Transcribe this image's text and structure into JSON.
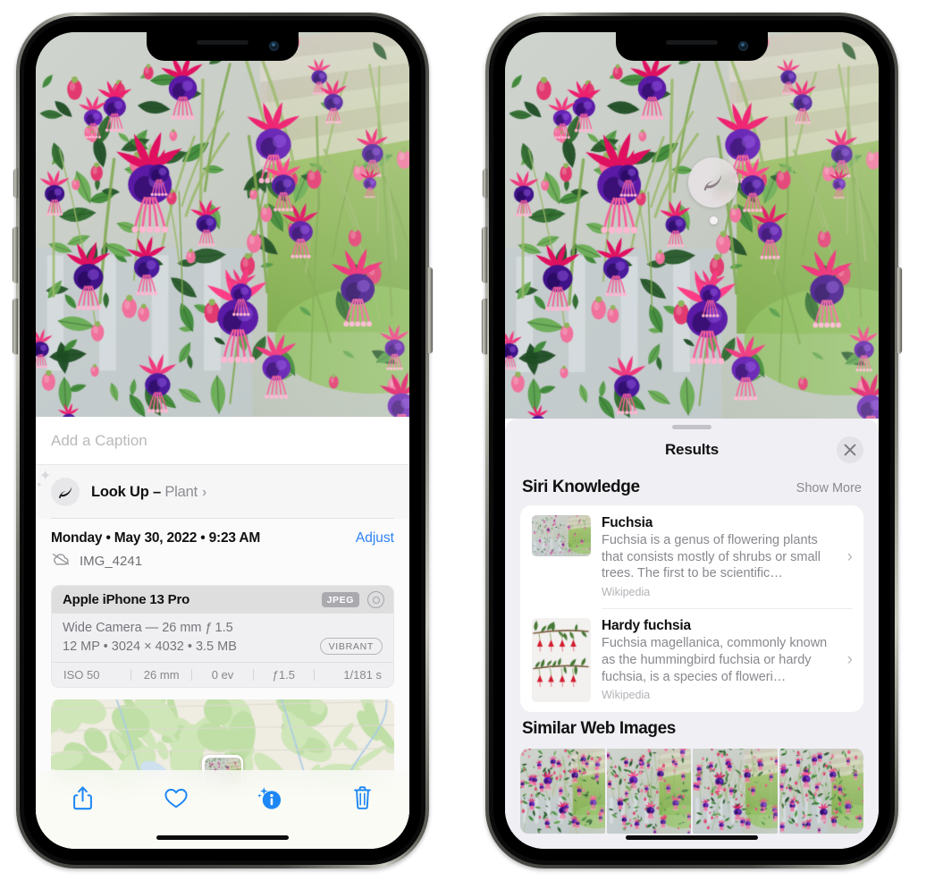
{
  "left_phone": {
    "photo_alt": "Fuchsia flowers hanging basket",
    "caption_field": {
      "placeholder": "Add a Caption",
      "value": ""
    },
    "look_up": {
      "label": "Look Up",
      "dash": " – ",
      "subject": "Plant",
      "chevron": "›",
      "icon": "leaf-icon",
      "sparkle": "✦"
    },
    "meta": {
      "datetime": "Monday • May 30, 2022 • 9:23 AM",
      "adjust_label": "Adjust",
      "filename": "IMG_4241",
      "cloud_icon": "icloud-slash-icon"
    },
    "exif": {
      "device": "Apple iPhone 13 Pro",
      "format_badge": "JPEG",
      "lens_icon": "aperture-icon",
      "lens_line": "Wide Camera — 26 mm ƒ 1.5",
      "size_line": "12 MP  •  3024 × 4032  •  3.5 MB",
      "style_badge": "VIBRANT",
      "stats": [
        "ISO 50",
        "26 mm",
        "0 ev",
        "ƒ1.5",
        "1/181 s"
      ]
    },
    "toolbar": [
      {
        "name": "share-button",
        "icon": "share-icon"
      },
      {
        "name": "favorite-button",
        "icon": "heart-icon"
      },
      {
        "name": "info-button",
        "icon": "info-sparkle-icon"
      },
      {
        "name": "delete-button",
        "icon": "trash-icon"
      }
    ]
  },
  "right_phone": {
    "badge": {
      "icon": "leaf-icon",
      "name": "visual-look-up-badge"
    },
    "sheet": {
      "title": "Results",
      "close_icon": "close-icon",
      "sections": [
        {
          "heading": "Siri Knowledge",
          "action": "Show More",
          "results": [
            {
              "title": "Fuchsia",
              "description": "Fuchsia is a genus of flowering plants that consists mostly of shrubs or small trees. The first to be scientific…",
              "source": "Wikipedia",
              "chevron": "›"
            },
            {
              "title": "Hardy fuchsia",
              "description": "Fuchsia magellanica, commonly known as the hummingbird fuchsia or hardy fuchsia, is a species of floweri…",
              "source": "Wikipedia",
              "chevron": "›"
            }
          ]
        },
        {
          "heading": "Similar Web Images",
          "images": 4
        }
      ]
    }
  },
  "colors": {
    "accent_blue": "#2b82f6",
    "sheet_bg": "#f0eff4",
    "card_white": "#ffffff",
    "secondary_text": "#88888e",
    "badge_gray": "#a9a9ae"
  }
}
